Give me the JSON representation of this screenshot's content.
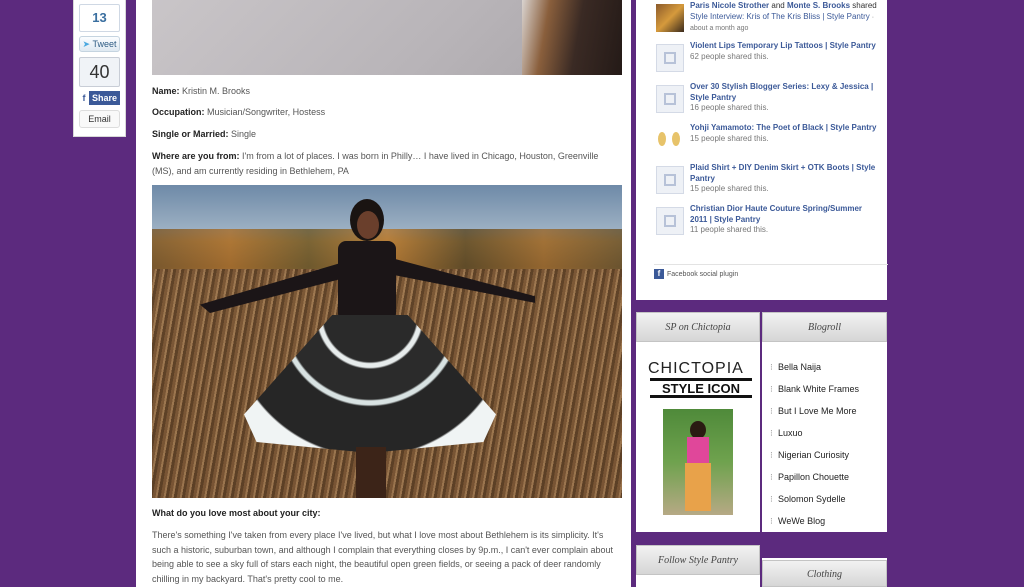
{
  "share_bar": {
    "tweet_count": "13",
    "tweet_label": "Tweet",
    "share_count": "40",
    "share_label": "Share",
    "email_label": "Email"
  },
  "article": {
    "fields": [
      {
        "label": "Name:",
        "value": "Kristin M. Brooks"
      },
      {
        "label": "Occupation:",
        "value": "Musician/Songwriter, Hostess"
      },
      {
        "label": "Single or Married:",
        "value": "Single"
      },
      {
        "label": "Where are you from:",
        "value": "I'm from a lot of places.  I was born in Philly… I have lived in Chicago, Houston, Greenville (MS), and am currently residing in Bethlehem, PA"
      }
    ],
    "question": "What do you love most about your city:",
    "answer": "There's something I've taken from every place I've lived, but what I love most about Bethlehem is its simplicity. It's such a historic, suburban town, and although I complain that everything closes by 9p.m., I can't ever complain about being able to see a sky full of stars each night, the beautiful open green fields, or seeing a pack of deer randomly chilling in my backyard.  That's pretty cool to me."
  },
  "facebook_activity": {
    "first": {
      "name1": "Paris Nicole Strother",
      "and": " and ",
      "name2": "Monte S. Brooks",
      "shared": " shared ",
      "link": "Style Interview: Kris of The Kris Bliss | Style Pantry",
      "meta": " · about a month ago"
    },
    "items": [
      {
        "title": "Violent Lips Temporary Lip Tattoos | Style Pantry",
        "meta": "62 people shared this."
      },
      {
        "title": "Over 30 Stylish Blogger Series: Lexy & Jessica | Style Pantry",
        "meta": "16 people shared this."
      },
      {
        "title": "Yohji Yamamoto: The Poet of Black | Style Pantry",
        "meta": "15 people shared this."
      },
      {
        "title": "Plaid Shirt + DIY Denim Skirt + OTK Boots | Style Pantry",
        "meta": "15 people shared this."
      },
      {
        "title": "Christian Dior Haute Couture Spring/Summer 2011 | Style Pantry",
        "meta": "11 people shared this."
      }
    ],
    "plugin_label": "Facebook social plugin"
  },
  "sidebar": {
    "tab_sp": "SP on Chictopia",
    "tab_blogroll": "Blogroll",
    "chictopia_logo": "CHICTOPIA",
    "style_icon": "STYLE ICON",
    "blogroll": [
      "Bella Naija",
      "Blank White Frames",
      "But I Love Me More",
      "Luxuo",
      "Nigerian Curiosity",
      "Papillon Chouette",
      "Solomon Sydelle",
      "WeWe Blog"
    ],
    "tab_follow": "Follow Style Pantry",
    "tab_clothing": "Clothing"
  }
}
